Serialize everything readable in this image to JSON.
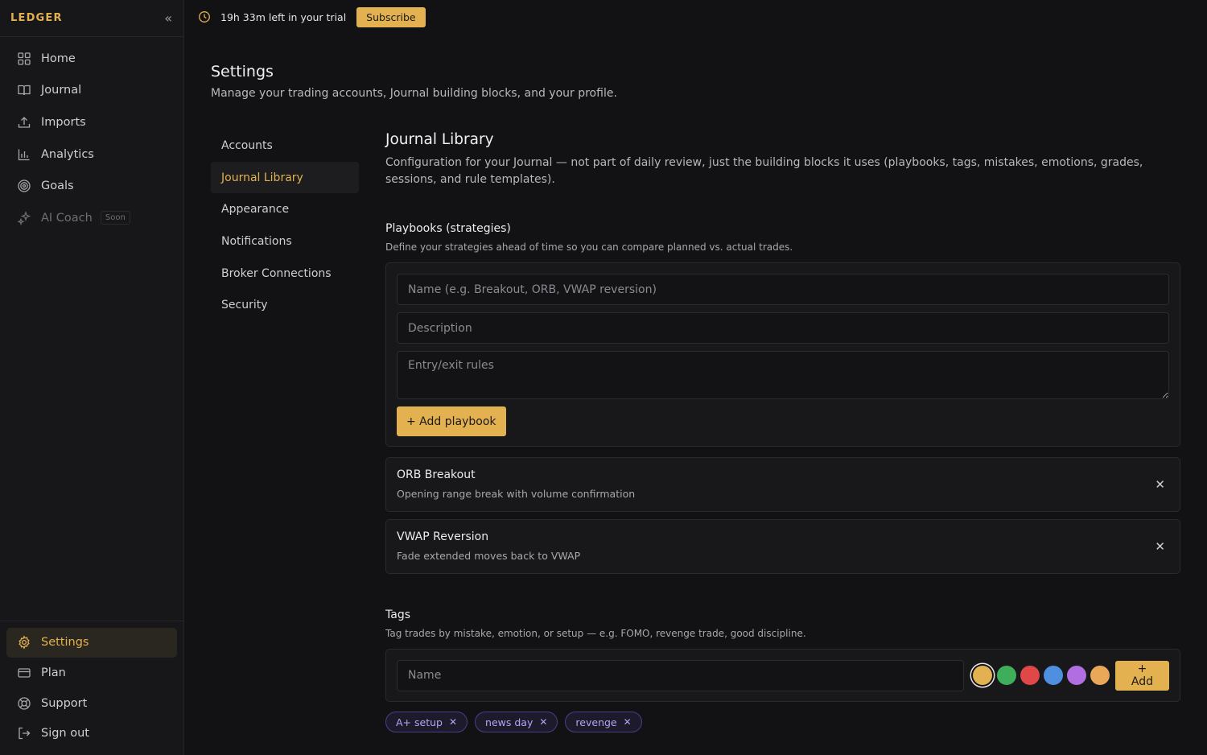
{
  "sidebar": {
    "brand": "LEDGER",
    "collapse_icon": "chevrons-left-icon",
    "items": [
      {
        "label": "Home",
        "icon": "grid-icon"
      },
      {
        "label": "Journal",
        "icon": "book-icon"
      },
      {
        "label": "Imports",
        "icon": "upload-icon"
      },
      {
        "label": "Analytics",
        "icon": "bar-chart-icon"
      },
      {
        "label": "Goals",
        "icon": "target-icon"
      },
      {
        "label": "AI Coach",
        "icon": "sparkles-icon",
        "badge": "Soon"
      }
    ],
    "bottom_items": [
      {
        "label": "Settings",
        "icon": "gear-icon",
        "active": true
      },
      {
        "label": "Plan",
        "icon": "card-icon"
      },
      {
        "label": "Support",
        "icon": "lifebuoy-icon"
      },
      {
        "label": "Sign out",
        "icon": "sign-out-icon"
      }
    ]
  },
  "topbar": {
    "trial_text": "19h 33m left in your trial",
    "subscribe_label": "Subscribe"
  },
  "page": {
    "title": "Settings",
    "subtitle": "Manage your trading accounts, Journal building blocks, and your profile."
  },
  "subnav": {
    "items": [
      "Accounts",
      "Journal Library",
      "Appearance",
      "Notifications",
      "Broker Connections",
      "Security"
    ],
    "active": "Journal Library"
  },
  "section": {
    "title": "Journal Library",
    "description": "Configuration for your Journal — not part of daily review, just the building blocks it uses (playbooks, tags, mistakes, emotions, grades, sessions, and rule templates)."
  },
  "playbooks": {
    "title": "Playbooks (strategies)",
    "description": "Define your strategies ahead of time so you can compare planned vs. actual trades.",
    "name_placeholder": "Name (e.g. Breakout, ORB, VWAP reversion)",
    "description_placeholder": "Description",
    "rules_placeholder": "Entry/exit rules",
    "add_label": "+ Add playbook",
    "list": [
      {
        "name": "ORB Breakout",
        "desc": "Opening range break with volume confirmation"
      },
      {
        "name": "VWAP Reversion",
        "desc": "Fade extended moves back to VWAP"
      }
    ]
  },
  "tags": {
    "title": "Tags",
    "description": "Tag trades by mistake, emotion, or setup — e.g. FOMO, revenge trade, good discipline.",
    "name_placeholder": "Name",
    "add_label": "+ Add",
    "colors": [
      "#e3b14f",
      "#3fae5a",
      "#e04848",
      "#4f8fe0",
      "#b06ee0",
      "#e8a857"
    ],
    "chips": [
      "A+ setup",
      "news day",
      "revenge"
    ]
  }
}
